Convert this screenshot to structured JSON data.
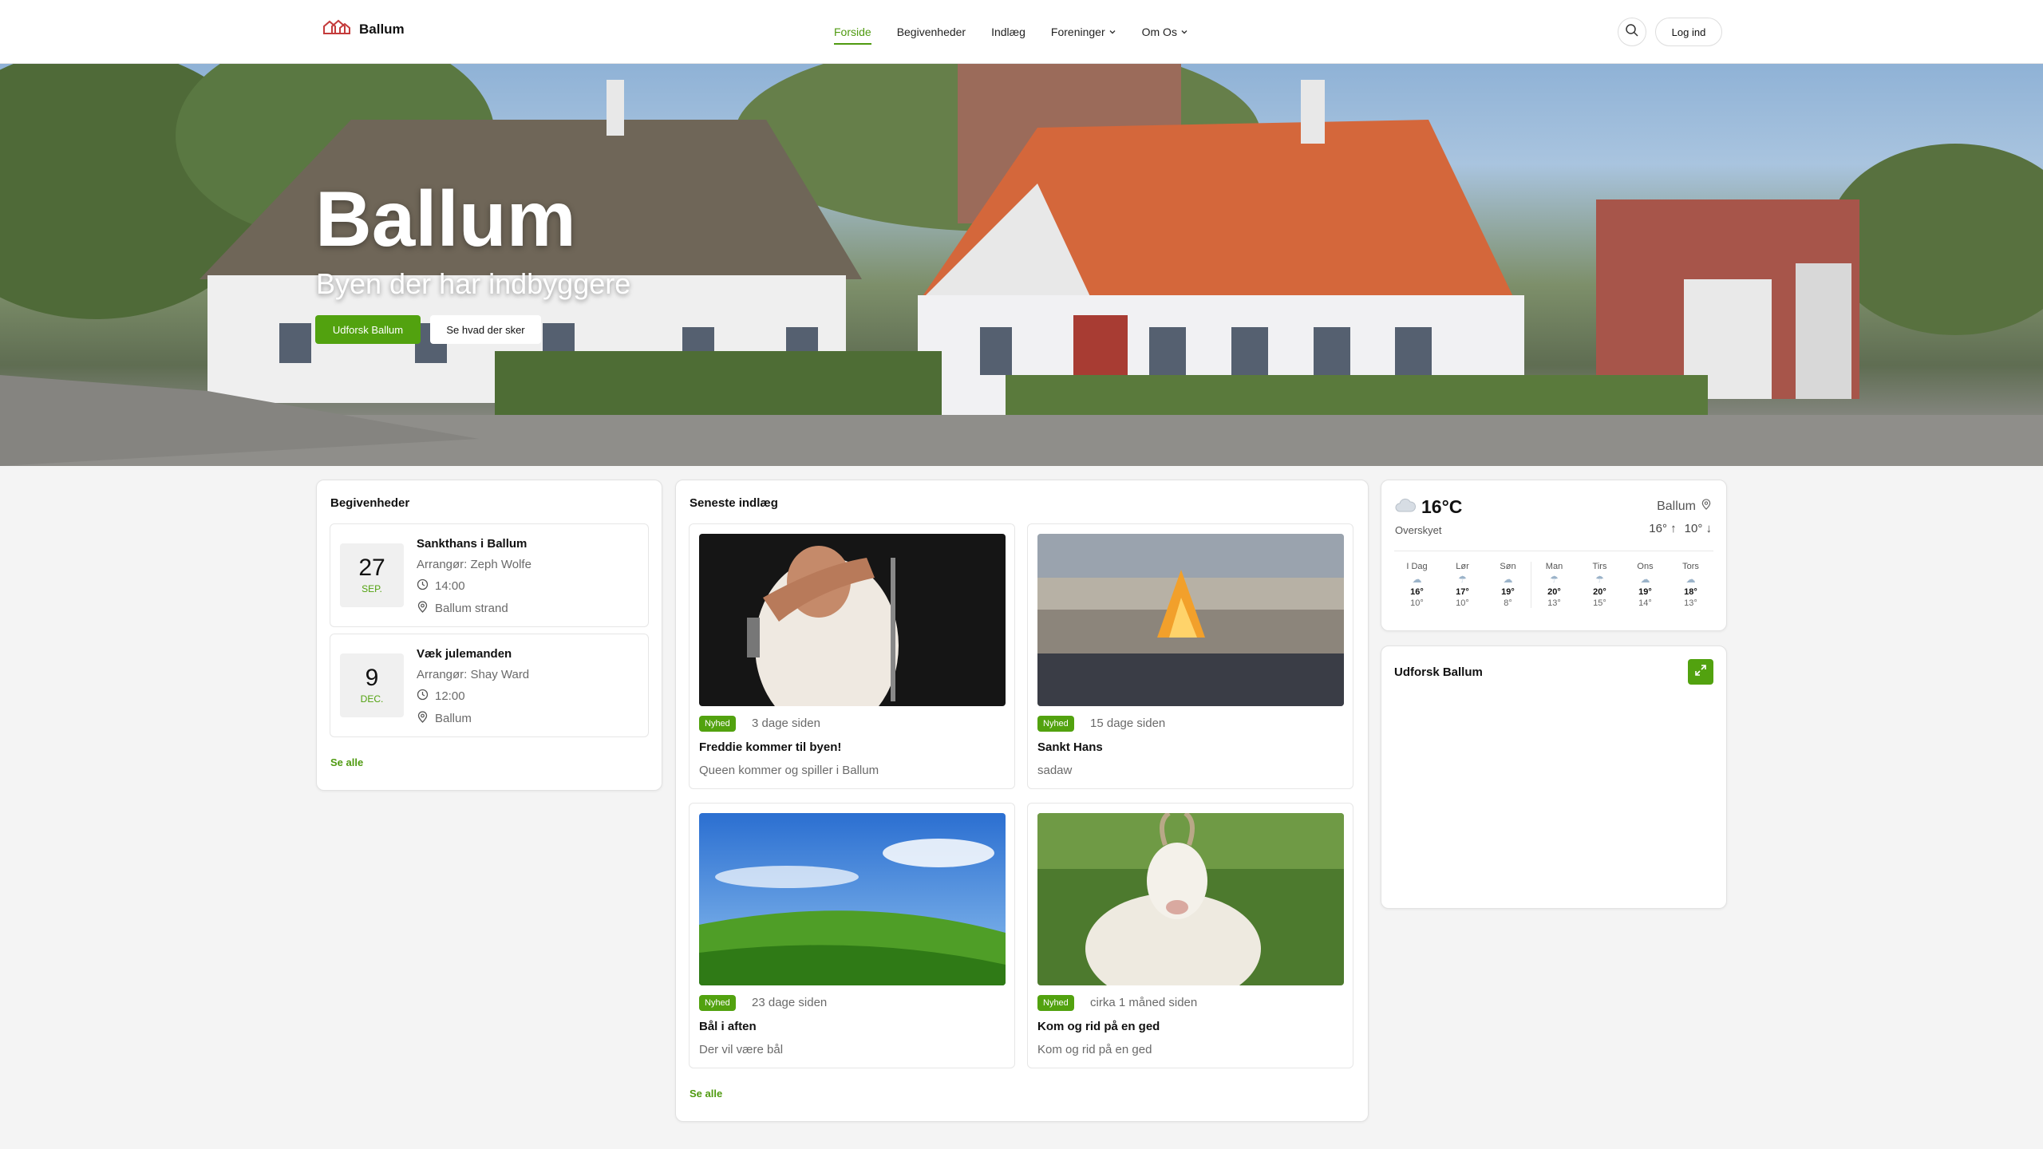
{
  "header": {
    "site_name": "Ballum",
    "nav": [
      {
        "label": "Forside",
        "active": true
      },
      {
        "label": "Begivenheder"
      },
      {
        "label": "Indlæg"
      },
      {
        "label": "Foreninger",
        "dropdown": true
      },
      {
        "label": "Om Os",
        "dropdown": true
      }
    ],
    "login_label": "Log ind"
  },
  "hero": {
    "title": "Ballum",
    "subtitle": "Byen der har indbyggere",
    "primary_button": "Udforsk Ballum",
    "secondary_button": "Se hvad der sker"
  },
  "events": {
    "title": "Begivenheder",
    "items": [
      {
        "day": "27",
        "month": "SEP.",
        "title": "Sankthans i Ballum",
        "organizer": "Arrangør: Zeph Wolfe",
        "time": "14:00",
        "location": "Ballum strand"
      },
      {
        "day": "9",
        "month": "DEC.",
        "title": "Væk julemanden",
        "organizer": "Arrangør: Shay Ward",
        "time": "12:00",
        "location": "Ballum"
      }
    ],
    "see_all": "Se alle"
  },
  "posts": {
    "title": "Seneste indlæg",
    "items": [
      {
        "badge": "Nyhed",
        "date": "3 dage siden",
        "title": "Freddie kommer til byen!",
        "desc": "Queen kommer og spiller i Ballum"
      },
      {
        "badge": "Nyhed",
        "date": "15 dage siden",
        "title": "Sankt Hans",
        "desc": "sadaw"
      },
      {
        "badge": "Nyhed",
        "date": "23 dage siden",
        "title": "Bål i aften",
        "desc": "Der vil være bål"
      },
      {
        "badge": "Nyhed",
        "date": "cirka 1 måned siden",
        "title": "Kom og rid på en ged",
        "desc": "Kom og rid på en ged"
      }
    ],
    "see_all": "Se alle"
  },
  "weather": {
    "temp": "16°C",
    "condition": "Overskyet",
    "location": "Ballum",
    "high": "16°",
    "low": "10°",
    "forecast": [
      {
        "day": "I Dag",
        "icon": "cloud",
        "hi": "16°",
        "lo": "10°"
      },
      {
        "day": "Lør",
        "icon": "rain",
        "hi": "17°",
        "lo": "10°"
      },
      {
        "day": "Søn",
        "icon": "cloud",
        "hi": "19°",
        "lo": "8°"
      },
      {
        "day": "Man",
        "icon": "rain",
        "hi": "20°",
        "lo": "13°"
      },
      {
        "day": "Tirs",
        "icon": "rain",
        "hi": "20°",
        "lo": "15°"
      },
      {
        "day": "Ons",
        "icon": "cloud",
        "hi": "19°",
        "lo": "14°"
      },
      {
        "day": "Tors",
        "icon": "cloud",
        "hi": "18°",
        "lo": "13°"
      }
    ]
  },
  "explore": {
    "title": "Udforsk Ballum"
  },
  "colors": {
    "accent": "#52a20f",
    "background": "#f4f4f4"
  }
}
